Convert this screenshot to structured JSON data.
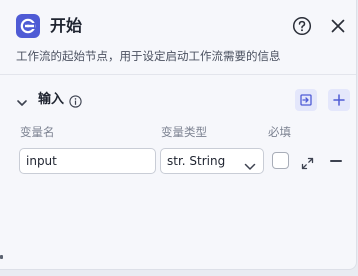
{
  "header": {
    "title": "开始",
    "icon": "start-node-icon",
    "accent": "#4f5bd5"
  },
  "description": "工作流的起始节点，用于设定启动工作流需要的信息",
  "section": {
    "label": "输入"
  },
  "columns": {
    "name": "变量名",
    "type": "变量类型",
    "required": "必填"
  },
  "row": {
    "name_value": "input",
    "type_value": "str. String",
    "required": false
  }
}
